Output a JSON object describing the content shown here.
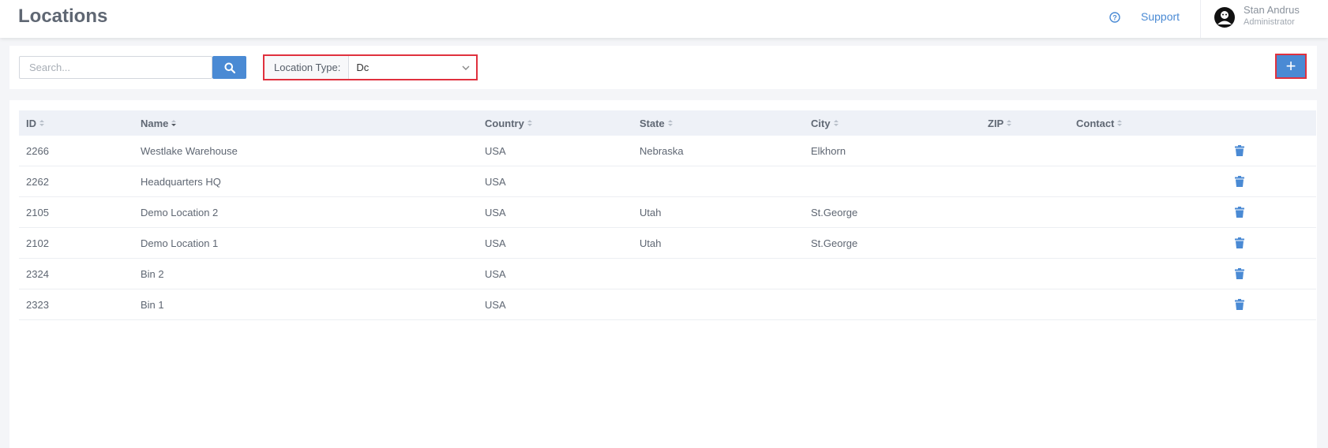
{
  "header": {
    "title": "Locations",
    "support_label": "Support",
    "help_icon": "question-circle-icon",
    "user": {
      "name": "Stan Andrus",
      "role": "Administrator",
      "avatar_icon": "user-avatar-icon"
    }
  },
  "toolbar": {
    "search_placeholder": "Search...",
    "search_value": "",
    "location_type_label": "Location Type:",
    "location_type_value": "Dc",
    "add_label": "+"
  },
  "table": {
    "columns": [
      "ID",
      "Name",
      "Country",
      "State",
      "City",
      "ZIP",
      "Contact"
    ],
    "rows": [
      {
        "id": "2266",
        "name": "Westlake Warehouse",
        "country": "USA",
        "state": "Nebraska",
        "city": "Elkhorn",
        "zip": "",
        "contact": ""
      },
      {
        "id": "2262",
        "name": "Headquarters HQ",
        "country": "USA",
        "state": "",
        "city": "",
        "zip": "",
        "contact": ""
      },
      {
        "id": "2105",
        "name": "Demo Location 2",
        "country": "USA",
        "state": "Utah",
        "city": "St.George",
        "zip": "",
        "contact": ""
      },
      {
        "id": "2102",
        "name": "Demo Location 1",
        "country": "USA",
        "state": "Utah",
        "city": "St.George",
        "zip": "",
        "contact": ""
      },
      {
        "id": "2324",
        "name": "Bin 2",
        "country": "USA",
        "state": "",
        "city": "",
        "zip": "",
        "contact": ""
      },
      {
        "id": "2323",
        "name": "Bin 1",
        "country": "USA",
        "state": "",
        "city": "",
        "zip": "",
        "contact": ""
      }
    ]
  },
  "colors": {
    "accent": "#4a8ad4",
    "highlight_border": "#e0313e",
    "header_bg": "#eef1f7"
  }
}
